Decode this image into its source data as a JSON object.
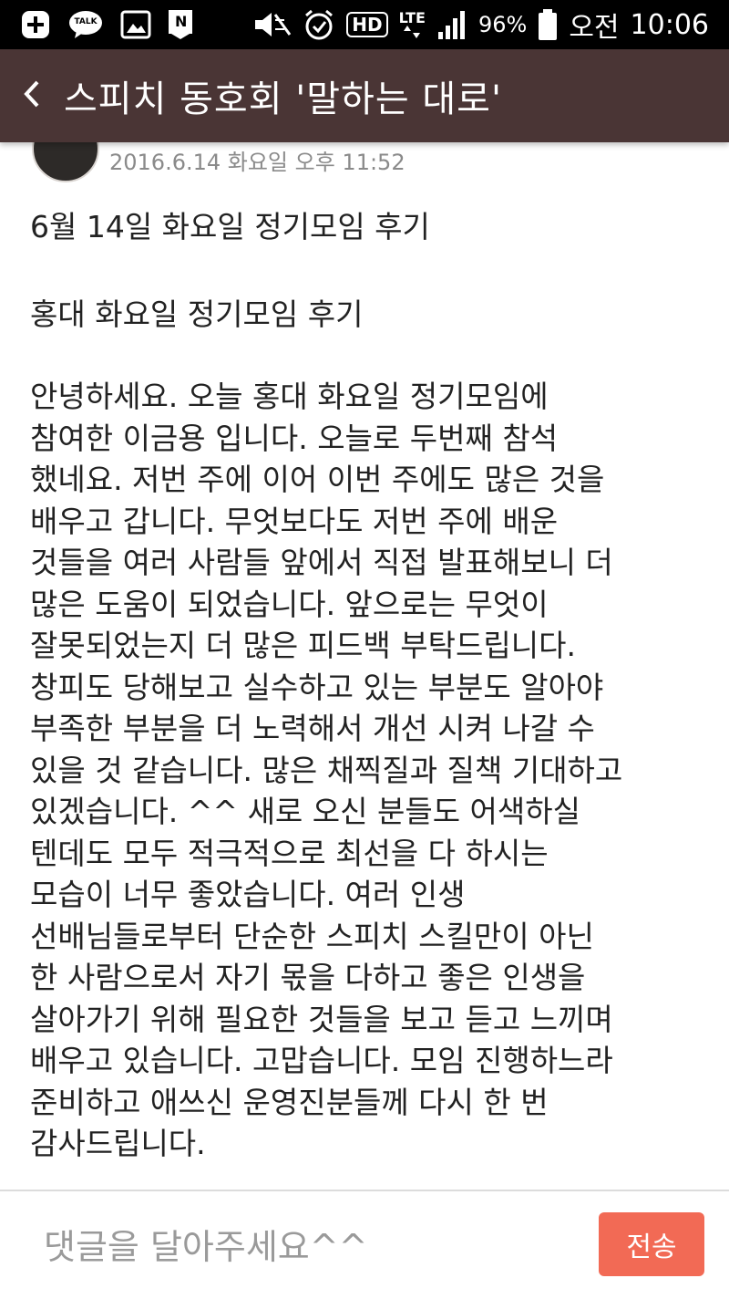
{
  "status_bar": {
    "battery": "96%",
    "ampm": "오전",
    "time": "10:06",
    "hd_label": "HD",
    "lte_label": "LTE",
    "kakao_label": "TALK",
    "naver_label": "N",
    "icons": [
      "plus-icon",
      "kakaotalk-icon",
      "gallery-icon",
      "naver-icon",
      "mute-icon",
      "alarm-icon",
      "hd-icon",
      "lte-icon",
      "signal-icon",
      "battery-icon"
    ]
  },
  "header": {
    "title": "스피치 동호회 '말하는 대로'",
    "back_icon": "chevron-left-icon",
    "color": "#4a3535"
  },
  "post": {
    "date": "2016.6.14 화요일 오후 11:52",
    "title": "6월 14일 화요일 정기모임 후기",
    "subtitle": "홍대 화요일 정기모임 후기",
    "body_lines": [
      "안녕하세요. 오늘 홍대 화요일 정기모임에",
      "참여한 이금용 입니다. 오늘로 두번째 참석",
      "했네요. 저번 주에 이어 이번 주에도 많은 것을",
      "배우고 갑니다. 무엇보다도 저번 주에 배운",
      "것들을 여러 사람들 앞에서 직접 발표해보니 더",
      "많은 도움이 되었습니다. 앞으로는 무엇이",
      "잘못되었는지 더 많은 피드백 부탁드립니다.",
      "창피도 당해보고 실수하고 있는 부분도 알아야",
      "부족한 부분을 더 노력해서 개선 시켜 나갈 수",
      "있을 것 같습니다. 많은 채찍질과 질책 기대하고",
      "있겠습니다. ^^ 새로 오신 분들도 어색하실",
      "텐데도 모두 적극적으로 최선을 다 하시는",
      "모습이 너무 좋았습니다. 여러 인생",
      "선배님들로부터 단순한 스피치 스킬만이 아닌",
      "한 사람으로서 자기 몫을 다하고 좋은 인생을",
      "살아가기 위해 필요한 것들을 보고 듣고 느끼며",
      "배우고 있습니다. 고맙습니다. 모임 진행하느라",
      "준비하고 애쓰신 운영진분들께 다시 한 번",
      "감사드립니다."
    ]
  },
  "comment": {
    "placeholder": "댓글을 달아주세요^^",
    "send_label": "전송",
    "send_color": "#f26a55"
  }
}
